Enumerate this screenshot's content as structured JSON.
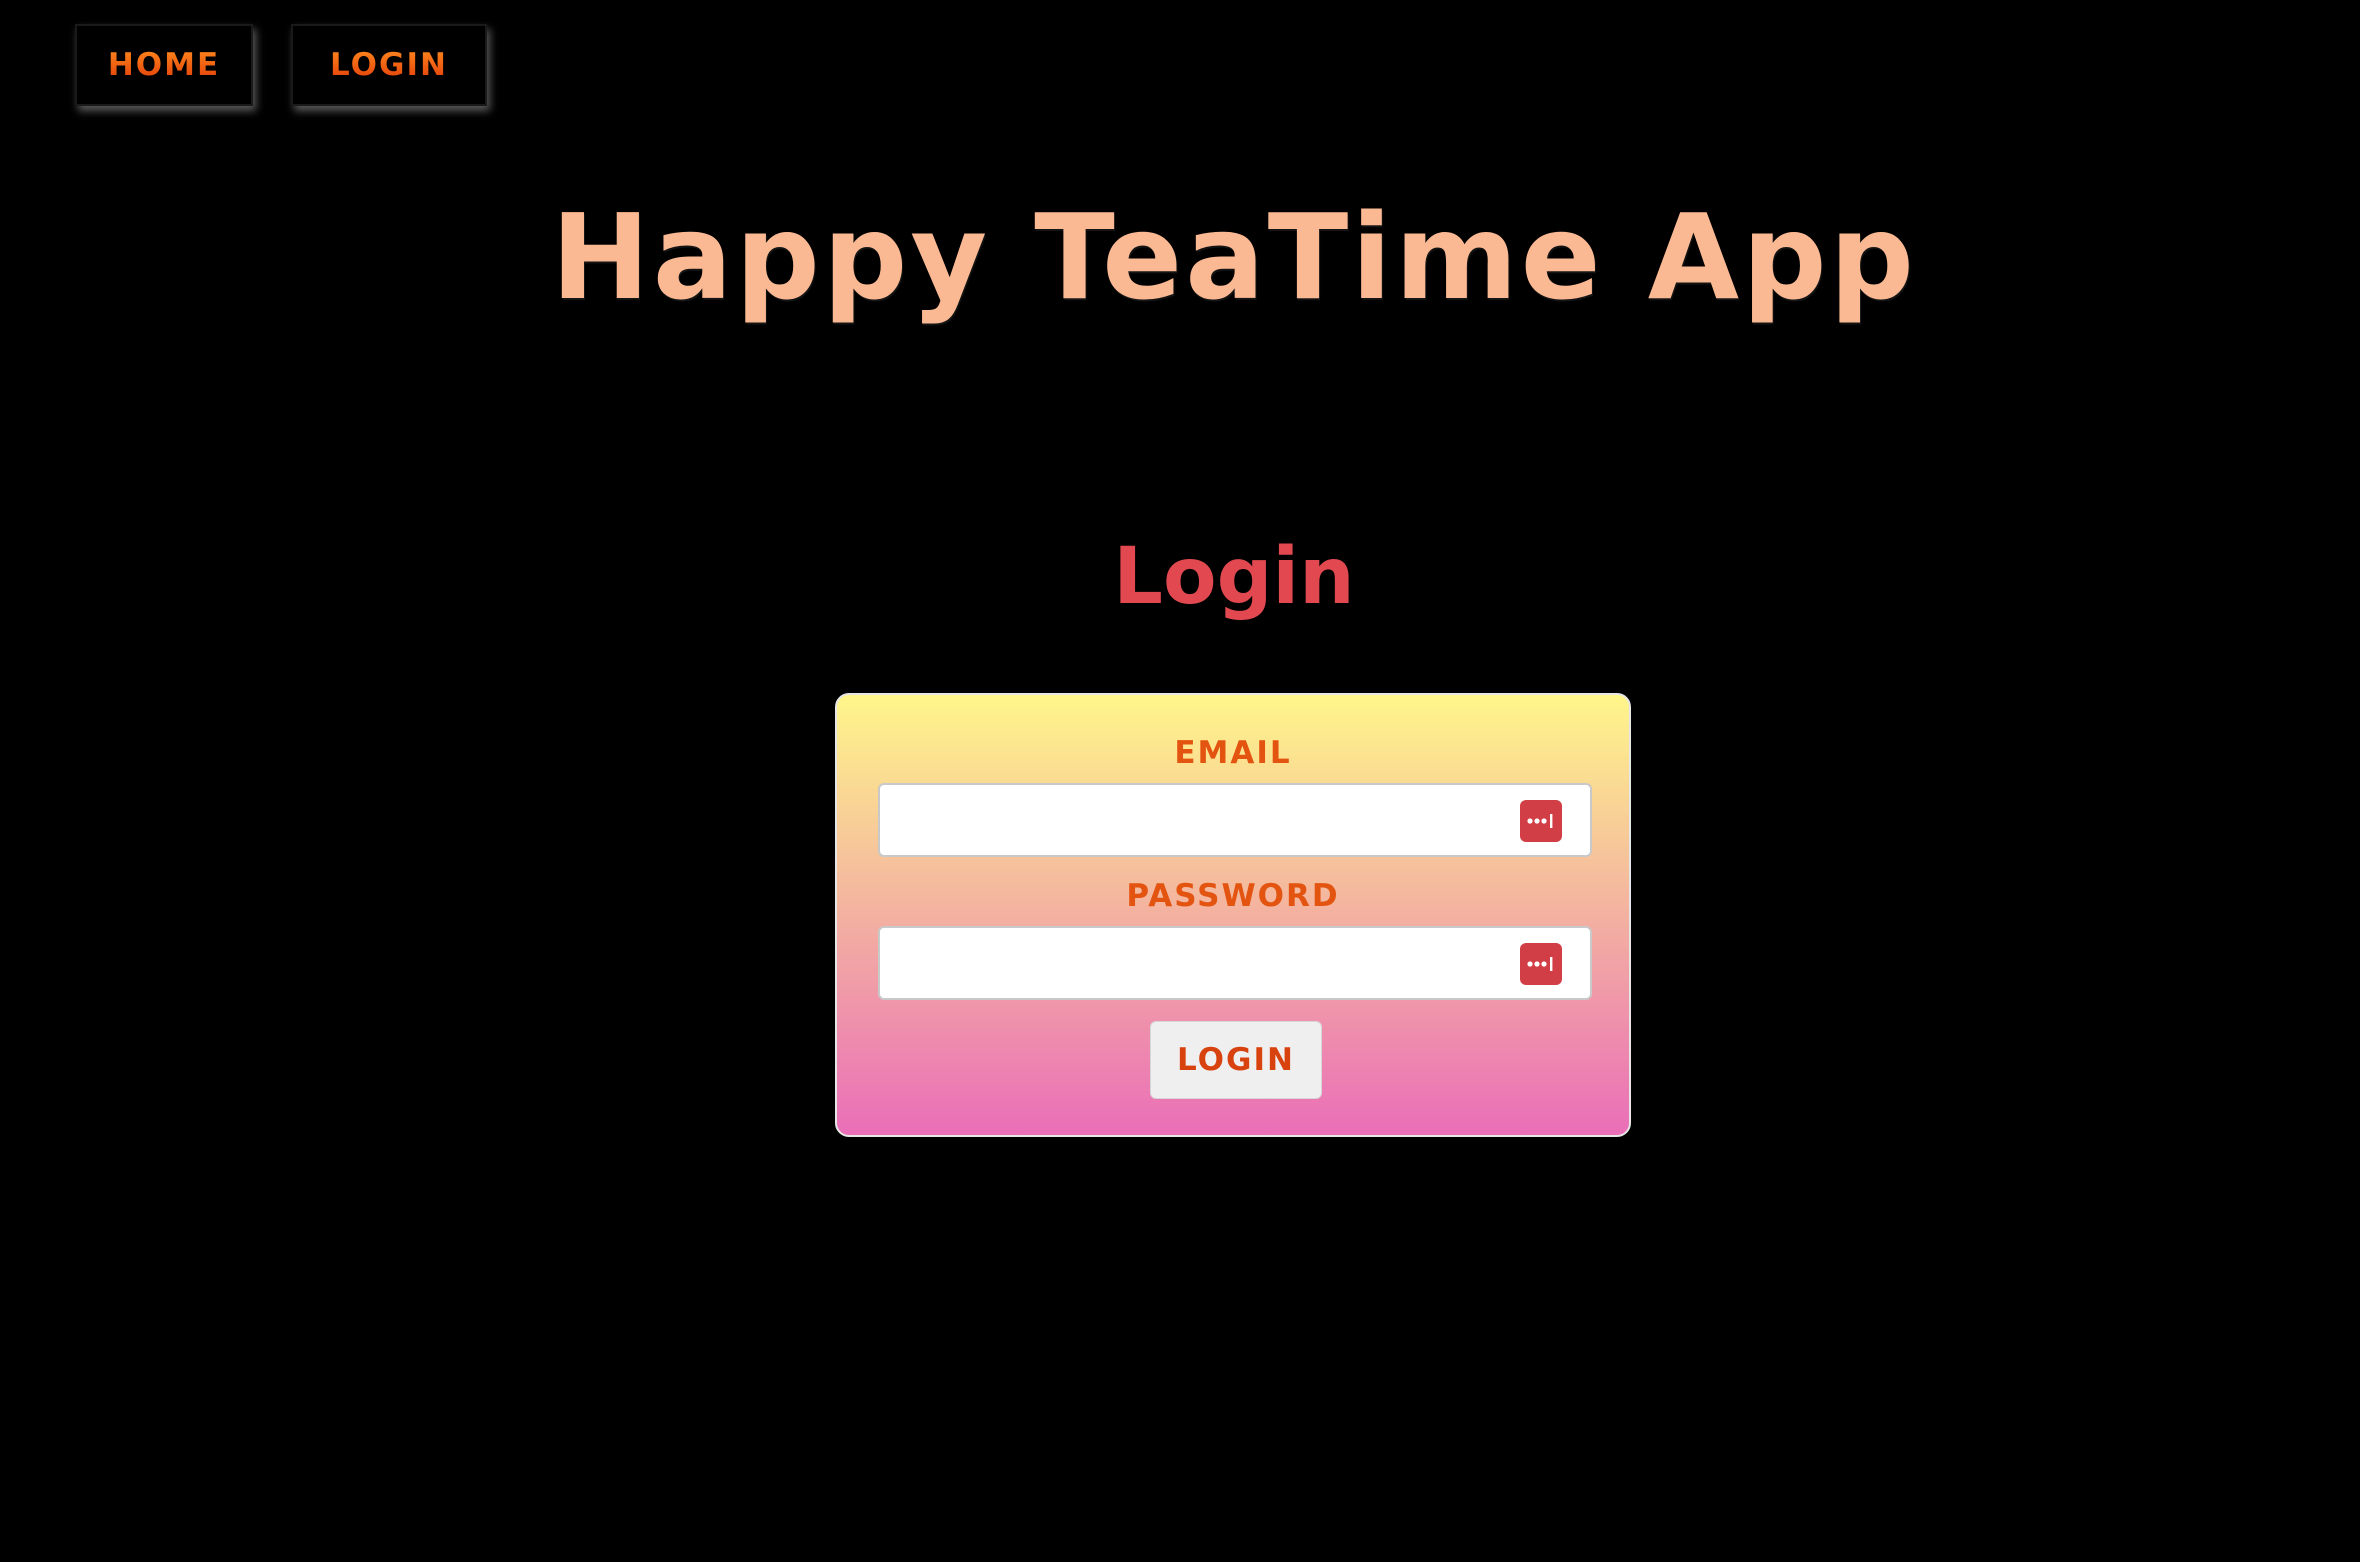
{
  "nav": {
    "home_label": "Home",
    "login_label": "Login"
  },
  "header": {
    "app_title": "Happy TeaTime App"
  },
  "login": {
    "heading": "Login",
    "email_label": "Email",
    "email_value": "",
    "password_label": "Password",
    "password_value": "",
    "submit_label": "Login",
    "password_manager_icon": "password-dots-icon"
  },
  "colors": {
    "background": "#000000",
    "title": "#fbb993",
    "heading": "#e2484f",
    "accent_orange": "#e35410",
    "card_gradient_top": "#fff68a",
    "card_gradient_bottom": "#ea6eb8",
    "icon_red": "#d23e46"
  }
}
